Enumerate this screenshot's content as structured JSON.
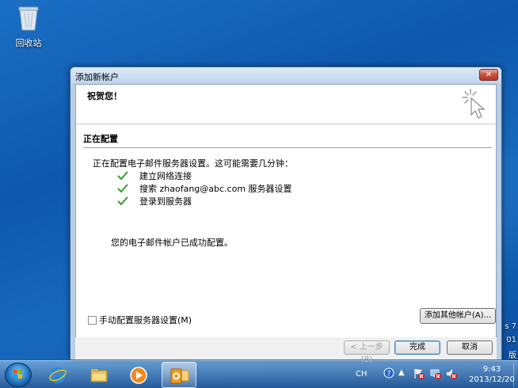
{
  "desktop": {
    "recycle_bin_label": "回收站",
    "edge_fragments": [
      "s 7",
      "01",
      "版"
    ]
  },
  "dialog": {
    "title": "添加新帐户",
    "close_label": "✕",
    "header": "祝贺您！",
    "section_title": "正在配置",
    "intro": "正在配置电子邮件服务器设置。这可能需要几分钟：",
    "steps": [
      {
        "label": "建立网络连接"
      },
      {
        "label": "搜索 zhaofang@abc.com 服务器设置"
      },
      {
        "label": "登录到服务器"
      }
    ],
    "success_message": "您的电子邮件帐户已成功配置。",
    "manual_config_label": "手动配置服务器设置(M)",
    "add_other_account_label": "添加其他帐户(A)...",
    "back_label": "< 上一步(B)",
    "finish_label": "完成",
    "cancel_label": "取消"
  },
  "taskbar": {
    "language": "CH",
    "tray_arrow": "▲",
    "time": "9:43",
    "date": "2013/12/20"
  },
  "colors": {
    "check_green": "#3a9b2d",
    "accent_blue": "#1a6fc4"
  }
}
